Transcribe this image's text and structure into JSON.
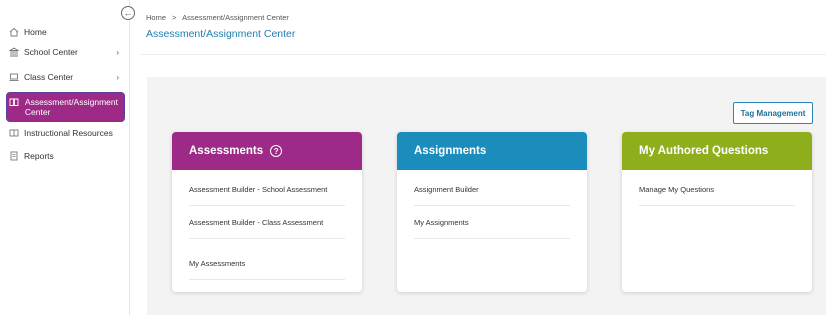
{
  "sidebar": {
    "collapse_icon": "arrow-left-circle-icon",
    "items": [
      {
        "label": "Home",
        "icon": "home-icon"
      },
      {
        "label": "School Center",
        "icon": "school-icon",
        "chevron": "›"
      },
      {
        "label": "Class Center",
        "icon": "laptop-icon",
        "chevron": "›"
      },
      {
        "label": "Assessment/Assignment Center",
        "icon": "book-icon"
      },
      {
        "label": "Instructional Resources",
        "icon": "resources-icon"
      },
      {
        "label": "Reports",
        "icon": "report-icon"
      }
    ]
  },
  "breadcrumb": {
    "home": "Home",
    "separator": ">",
    "current": "Assessment/Assignment Center"
  },
  "page_title": "Assessment/Assignment Center",
  "toolbar": {
    "tag_management_label": "Tag Management"
  },
  "cards": {
    "assessments": {
      "title": "Assessments",
      "color": "#9c2a86",
      "links": [
        "Assessment Builder - School Assessment",
        "Assessment Builder - Class Assessment",
        "My Assessments"
      ]
    },
    "assignments": {
      "title": "Assignments",
      "color": "#1a8dbd",
      "links": [
        "Assignment Builder",
        "My Assignments"
      ]
    },
    "authored": {
      "title": "My Authored Questions",
      "color": "#8eae1c",
      "links": [
        "Manage My Questions"
      ]
    }
  }
}
